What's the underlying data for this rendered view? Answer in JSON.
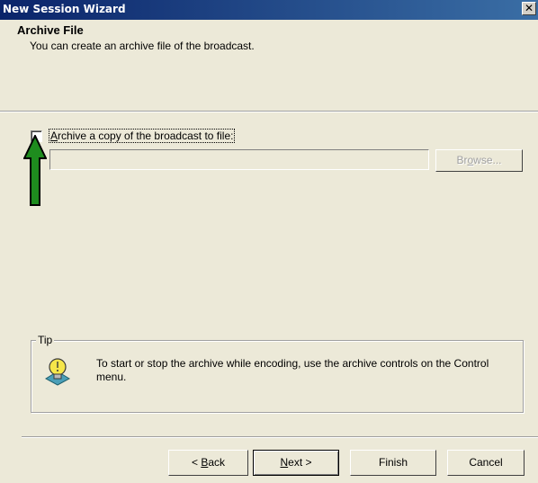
{
  "window": {
    "title": "New Session Wizard",
    "close_glyph": "✕"
  },
  "header": {
    "title": "Archive File",
    "subtitle": "You can create an archive file of the broadcast."
  },
  "archive": {
    "checkbox_label_prefix": "",
    "checkbox_label_accel": "A",
    "checkbox_label_rest": "rchive a copy of the broadcast to file:",
    "checked": false,
    "file_path": "",
    "browse_pre": "Br",
    "browse_accel": "o",
    "browse_post": "wse..."
  },
  "tip": {
    "legend": "Tip",
    "icon": "lightbulb-icon",
    "text": "To start or stop the archive while encoding, use the archive controls on the Control menu."
  },
  "annotation": {
    "icon": "green-arrow-up-icon",
    "color": "#1e8c1e"
  },
  "buttons": {
    "back_pre": "< ",
    "back_accel": "B",
    "back_post": "ack",
    "next_accel": "N",
    "next_post": "ext >",
    "finish": "Finish",
    "cancel": "Cancel"
  }
}
